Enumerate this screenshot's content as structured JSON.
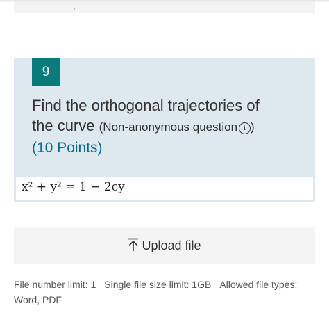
{
  "question": {
    "number": "9",
    "title_line1": "Find the orthogonal trajectories of",
    "title_line2": "the curve",
    "subtitle": "(Non-anonymous question",
    "subtitle_close": ")",
    "points": "(10 Points)",
    "info_icon": "info-icon"
  },
  "formula": {
    "text": "x² + y² = 1 − 2cy"
  },
  "upload": {
    "label": "Upload file",
    "icon": "upload-arrow-icon"
  },
  "limits": {
    "file_number": "File number limit: 1",
    "file_size": "Single file size limit: 1GB",
    "allowed_types": "Allowed file types: Word, PDF"
  },
  "colors": {
    "accent": "#0b7a7b",
    "points": "#0b6a8c",
    "card_bg": "#dde9ef"
  }
}
